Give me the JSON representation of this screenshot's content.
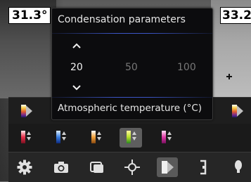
{
  "readings": {
    "left_temp": "31.3°",
    "right_temp": "33.2"
  },
  "dialog": {
    "title": "Condensation parameters",
    "values": [
      "20",
      "50",
      "100"
    ],
    "selected_value": "20",
    "footer": "Atmospheric temperature (°C)"
  },
  "icons": {
    "up": "chevron-up-icon",
    "down": "chevron-down-icon",
    "settings": "gear-icon",
    "camera": "camera-icon",
    "overlay": "image-overlay-icon",
    "measure": "crosshair-icon",
    "palette": "palette-icon",
    "range": "bracket-icon",
    "light": "lamp-icon"
  },
  "colors": {
    "accent_line": "#3c56c8",
    "selected_bg": "#5e5e5e"
  }
}
